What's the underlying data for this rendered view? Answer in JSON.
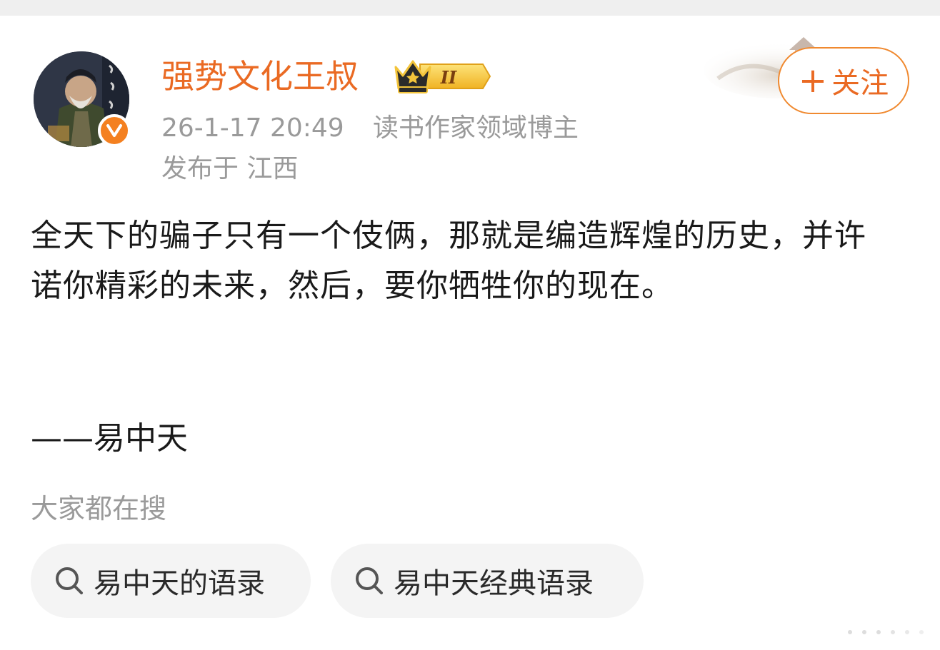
{
  "post": {
    "author": {
      "name": "强势文化王叔",
      "level_badge": "II",
      "verified_badge": "V"
    },
    "meta": {
      "time": "26-1-17 20:49",
      "category": "读书作家领域博主",
      "location": "发布于 江西"
    },
    "follow_button": {
      "plus": "+",
      "label": "关注"
    },
    "body": "全天下的骗子只有一个伎俩，那就是编造辉煌的历史，并许诺你精彩的未来，然后，要你牺牲你的现在。",
    "attribution": "——易中天"
  },
  "search": {
    "heading": "大家都在搜",
    "chips": [
      {
        "label": "易中天的语录",
        "icon": "search-icon"
      },
      {
        "label": "易中天经典语录",
        "icon": "search-icon"
      }
    ]
  },
  "colors": {
    "accent": "#ea6a23",
    "muted_text": "#9a9a9a",
    "body_text": "#1a1a1a",
    "chip_bg": "#f4f4f4",
    "verified": "#f48020",
    "gold": "#f3c43b"
  }
}
